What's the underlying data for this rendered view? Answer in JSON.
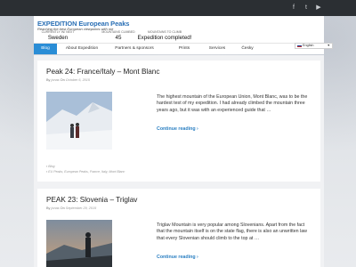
{
  "social": [
    "f",
    "t",
    "▶"
  ],
  "site": {
    "title": "EXPEDITION European Peaks",
    "tagline": "Reaching the best European viewpoints with me"
  },
  "stats": [
    {
      "label": "CURRENTLY IN/ NEXT",
      "value": "Sweden"
    },
    {
      "label": "MOUNTAINS CLIMBED",
      "value": "45"
    },
    {
      "label": "MOUNTAINS TO CLIMB",
      "value": "Expedition completed!"
    }
  ],
  "nav": [
    "Blog",
    "About Expedition",
    "Partners & sponsors",
    "Prints",
    "Services",
    "Česky"
  ],
  "language": "English",
  "posts": [
    {
      "title": "Peak 24: France/Italy – Mont Blanc",
      "by": "By",
      "author": "jonas",
      "on": "On",
      "date": "October 6, 2015",
      "excerpt": "The highest mountain of the European Union, Mont Blanc, was to be the hardest test of my expedition. I had already climbed the mountain three years ago, but it was with an experienced guide that …",
      "continue": "Continue reading",
      "category": "Blog",
      "tags": "EU Peaks, European Peaks, France, Italy, Mont Blanc"
    },
    {
      "title": "PEAK 23: Slovenia – Triglav",
      "by": "By",
      "author": "jonas",
      "on": "On",
      "date": "September 29, 2015",
      "excerpt": "Triglav Mountain is very popular among Slovenians. Apart from the fact that the mountain itself is on the state flag, there is also an unwritten law that every Slovenian should climb to the top at …",
      "continue": "Continue reading"
    }
  ]
}
